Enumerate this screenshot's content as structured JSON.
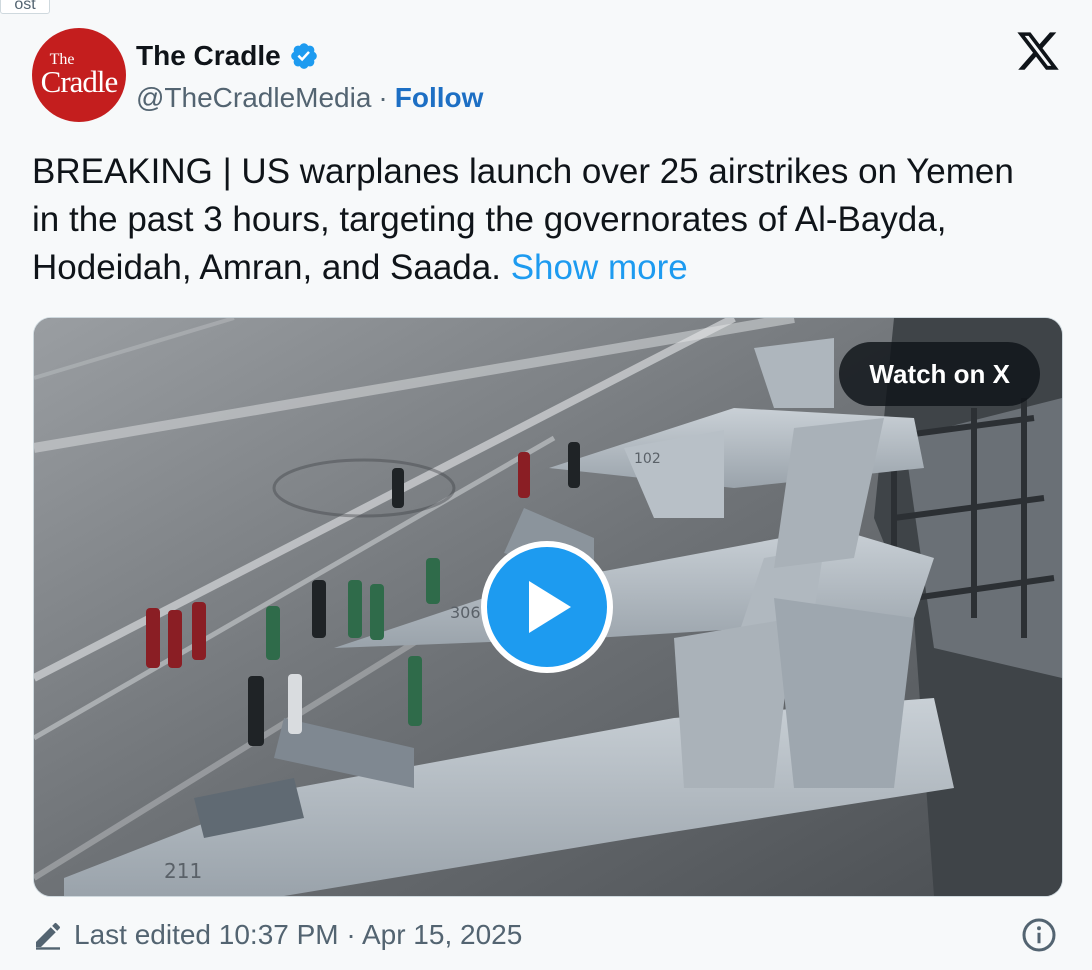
{
  "post_tag": "ost",
  "author": {
    "avatar_line1": "The",
    "avatar_line2": "Cradle",
    "name": "The Cradle",
    "handle": "@TheCradleMedia",
    "separator": "·",
    "follow_label": "Follow"
  },
  "tweet": {
    "text": "BREAKING | US warplanes launch over 25 airstrikes on Yemen in the past 3 hours, targeting the governorates of Al-Bayda, Hodeidah, Amran, and Saada.",
    "show_more": "Show more"
  },
  "media": {
    "watch_label": "Watch on X",
    "jet_numbers": [
      "102",
      "306",
      "211"
    ]
  },
  "footer": {
    "edited_label": "Last edited 10:37 PM · Apr 15, 2025"
  },
  "colors": {
    "accent": "#1d9bf0",
    "follow": "#1d6fc4",
    "avatar_bg": "#c41e1e",
    "muted": "#536471"
  },
  "icons": [
    "verified-badge-icon",
    "x-logo-icon",
    "play-icon",
    "pencil-icon",
    "info-icon"
  ]
}
